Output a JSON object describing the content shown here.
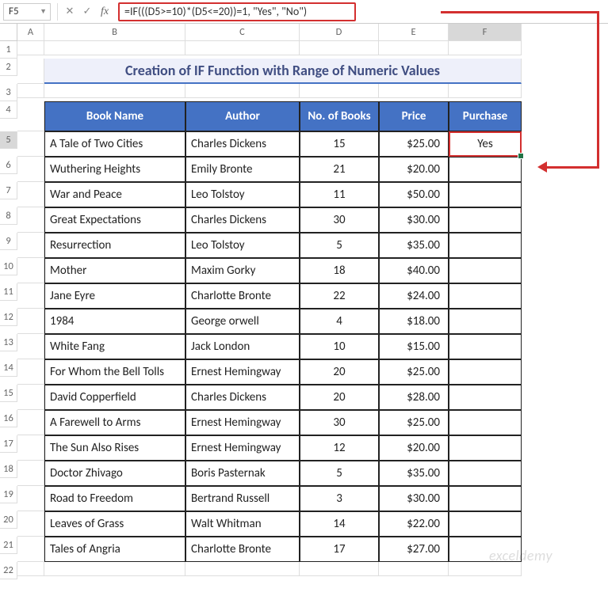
{
  "name_box": "F5",
  "formula_bar": "=IF(((D5>=10)*(D5<=20))=1, \"Yes\", \"No\")",
  "col_headers": [
    "A",
    "B",
    "C",
    "D",
    "E",
    "F"
  ],
  "row_headers": [
    "1",
    "2",
    "3",
    "4",
    "5",
    "6",
    "7",
    "8",
    "9",
    "10",
    "11",
    "12",
    "13",
    "14",
    "15",
    "16",
    "17",
    "18",
    "19",
    "20",
    "21",
    "22"
  ],
  "title": "Creation of IF Function with Range of Numeric Values",
  "headers": {
    "book": "Book Name",
    "author": "Author",
    "num": "No. of Books",
    "price": "Price",
    "purchase": "Purchase"
  },
  "selected_value": "Yes",
  "rows": [
    {
      "book": "A Tale of Two Cities",
      "author": "Charles Dickens",
      "num": "15",
      "price": "$25.00",
      "purchase": "Yes"
    },
    {
      "book": "Wuthering Heights",
      "author": "Emily Bronte",
      "num": "21",
      "price": "$20.00",
      "purchase": ""
    },
    {
      "book": "War and Peace",
      "author": "Leo Tolstoy",
      "num": "11",
      "price": "$50.00",
      "purchase": ""
    },
    {
      "book": "Great Expectations",
      "author": "Charles Dickens",
      "num": "30",
      "price": "$30.00",
      "purchase": ""
    },
    {
      "book": "Resurrection",
      "author": "Leo Tolstoy",
      "num": "5",
      "price": "$35.00",
      "purchase": ""
    },
    {
      "book": "Mother",
      "author": "Maxim Gorky",
      "num": "18",
      "price": "$40.00",
      "purchase": ""
    },
    {
      "book": "Jane Eyre",
      "author": "Charlotte Bronte",
      "num": "22",
      "price": "$24.00",
      "purchase": ""
    },
    {
      "book": "1984",
      "author": "George orwell",
      "num": "4",
      "price": "$18.00",
      "purchase": ""
    },
    {
      "book": "White Fang",
      "author": "Jack London",
      "num": "10",
      "price": "$15.00",
      "purchase": ""
    },
    {
      "book": "For Whom the Bell Tolls",
      "author": "Ernest Hemingway",
      "num": "20",
      "price": "$25.00",
      "purchase": ""
    },
    {
      "book": "David Copperfield",
      "author": "Charles Dickens",
      "num": "20",
      "price": "$28.00",
      "purchase": ""
    },
    {
      "book": "A Farewell to Arms",
      "author": "Ernest Hemingway",
      "num": "30",
      "price": "$25.00",
      "purchase": ""
    },
    {
      "book": "The Sun Also Rises",
      "author": "Ernest Hemingway",
      "num": "12",
      "price": "$20.00",
      "purchase": ""
    },
    {
      "book": "Doctor Zhivago",
      "author": "Boris Pasternak",
      "num": "5",
      "price": "$35.00",
      "purchase": ""
    },
    {
      "book": "Road to Freedom",
      "author": "Bertrand Russell",
      "num": "3",
      "price": "$30.00",
      "purchase": ""
    },
    {
      "book": "Leaves of Grass",
      "author": "Walt Whitman",
      "num": "14",
      "price": "$22.00",
      "purchase": ""
    },
    {
      "book": "Tales of Angria",
      "author": "Charlotte Bronte",
      "num": "17",
      "price": "$27.00",
      "purchase": ""
    }
  ],
  "watermark": "exceldemy"
}
